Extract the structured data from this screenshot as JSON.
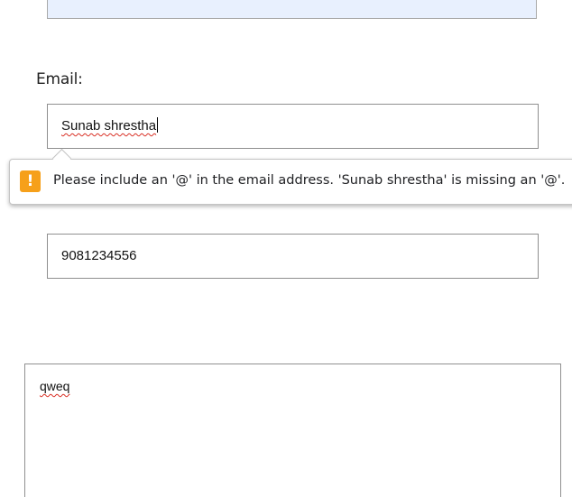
{
  "form": {
    "email_label": "Email:",
    "email_value": "Sunab shrestha",
    "phone_value": "9081234556",
    "message_value": "qweq"
  },
  "validation": {
    "message": "Please include an '@' in the email address. 'Sunab shrestha' is missing an '@'.",
    "icon": "!",
    "icon_color": "#f6a01a"
  },
  "colors": {
    "autofill_background": "#e8f0fe",
    "spellcheck_underline": "#d93025"
  }
}
